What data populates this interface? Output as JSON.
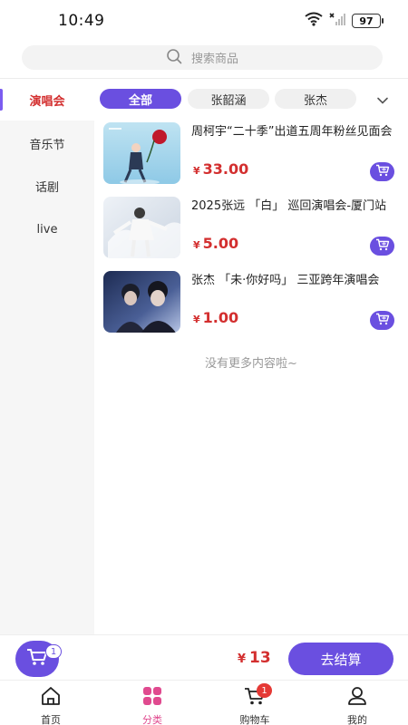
{
  "status_bar": {
    "time": "10:49",
    "battery": "97"
  },
  "search": {
    "placeholder": "搜索商品"
  },
  "sidebar": {
    "items": [
      {
        "label": "演唱会",
        "active": true
      },
      {
        "label": "音乐节",
        "active": false
      },
      {
        "label": "话剧",
        "active": false
      },
      {
        "label": "live",
        "active": false
      }
    ]
  },
  "tabs": [
    {
      "label": "全部",
      "active": true
    },
    {
      "label": "张韶涵",
      "active": false
    },
    {
      "label": "张杰",
      "active": false
    }
  ],
  "products": [
    {
      "title": "周柯宇“二十季”出道五周年粉丝见面会",
      "currency": "¥",
      "price": "33.00"
    },
    {
      "title": "2025张远 「白」 巡回演唱会-厦门站",
      "currency": "¥",
      "price": "5.00"
    },
    {
      "title": "张杰 「未·你好吗」 三亚跨年演唱会",
      "currency": "¥",
      "price": "1.00"
    }
  ],
  "no_more_text": "没有更多内容啦~",
  "checkout": {
    "cart_count": "1",
    "currency": "¥",
    "total": "13",
    "button_label": "去结算"
  },
  "bottom_nav": {
    "items": [
      {
        "label": "首页",
        "icon": "home-icon",
        "active": false
      },
      {
        "label": "分类",
        "icon": "category-icon",
        "active": true
      },
      {
        "label": "购物车",
        "icon": "cart-icon",
        "active": false,
        "badge": "1"
      },
      {
        "label": "我的",
        "icon": "user-icon",
        "active": false
      }
    ]
  },
  "colors": {
    "accent": "#6a4fe0",
    "price": "#d32f2f",
    "nav_active": "#e04a8f",
    "badge": "#e53935"
  }
}
